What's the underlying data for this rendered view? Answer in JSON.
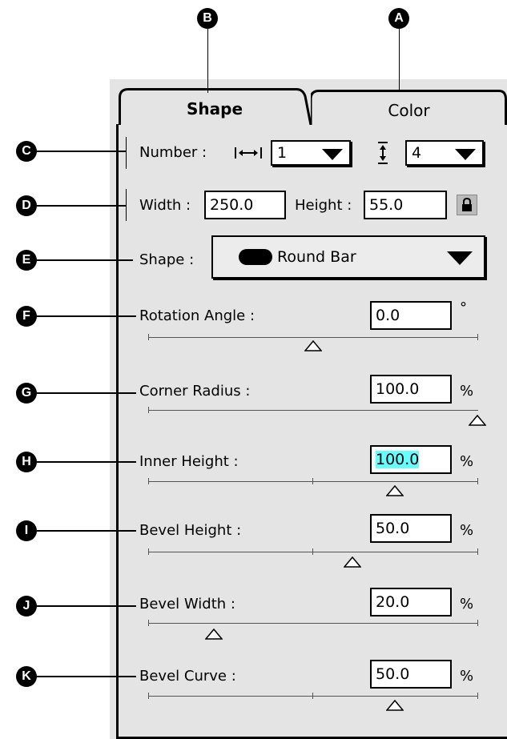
{
  "callouts": {
    "a": "A",
    "b": "B",
    "c": "C",
    "d": "D",
    "e": "E",
    "f": "F",
    "g": "G",
    "h": "H",
    "i": "I",
    "j": "J",
    "k": "K"
  },
  "tabs": {
    "shape": "Shape",
    "color": "Color"
  },
  "number": {
    "label": "Number :",
    "horizontal_value": "1",
    "vertical_value": "4"
  },
  "size": {
    "width_label": "Width :",
    "width_value": "250.0",
    "height_label": "Height :",
    "height_value": "55.0"
  },
  "shape": {
    "label": "Shape :",
    "selected": "Round Bar"
  },
  "sliders": [
    {
      "label": "Rotation Angle :",
      "value": "0.0",
      "unit": "°",
      "level": 0.5
    },
    {
      "label": "Corner Radius :",
      "value": "100.0",
      "unit": "%",
      "level": 1.0
    },
    {
      "label": "Inner Height :",
      "value": "100.0",
      "unit": "%",
      "level": 0.75
    },
    {
      "label": "Bevel Height :",
      "value": "50.0",
      "unit": "%",
      "level": 0.62
    },
    {
      "label": "Bevel Width :",
      "value": "20.0",
      "unit": "%",
      "level": 0.2
    },
    {
      "label": "Bevel Curve :",
      "value": "50.0",
      "unit": "%",
      "level": 0.75
    }
  ],
  "colors": {
    "highlight": "#66ffff",
    "panel": "#e4e4e4"
  }
}
